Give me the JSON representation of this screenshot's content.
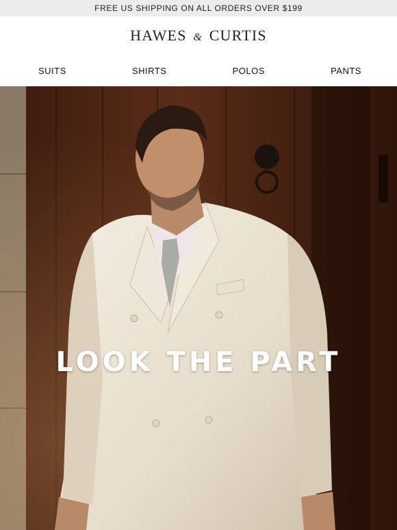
{
  "banner": {
    "text": "FREE US SHIPPING ON ALL ORDERS OVER $199"
  },
  "brand": {
    "part1": "HAWES",
    "amp": "&",
    "part2": "CURTIS"
  },
  "nav": {
    "items": [
      {
        "label": "SUITS"
      },
      {
        "label": "SHIRTS"
      },
      {
        "label": "POLOS"
      },
      {
        "label": "PANTS"
      }
    ]
  },
  "hero": {
    "headline": "LOOK THE PART",
    "colors": {
      "door": "#4a2414",
      "stone": "#8a7a66",
      "jacket": "#ece3d3",
      "text": "#ffffff"
    }
  }
}
